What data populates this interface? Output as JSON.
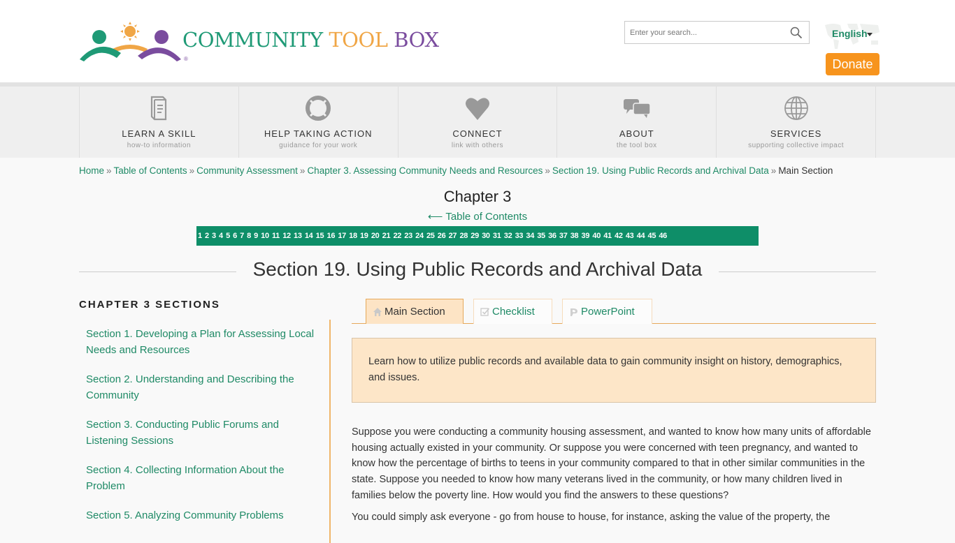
{
  "header": {
    "logo": {
      "word1": "COMMUNITY",
      "word2": "TOOL",
      "word3": "BOX",
      "registered": "®",
      "colors": {
        "green": "#1f9a76",
        "orange": "#f0a646",
        "purple": "#7a4c9e"
      }
    },
    "search": {
      "placeholder": "Enter your search...",
      "value": ""
    },
    "language": {
      "selected": "English"
    },
    "donate_label": "Donate"
  },
  "nav": {
    "items": [
      {
        "icon": "book-icon",
        "title": "LEARN A SKILL",
        "subtitle": "how-to information"
      },
      {
        "icon": "lifebuoy-icon",
        "title": "HELP TAKING ACTION",
        "subtitle": "guidance for your work"
      },
      {
        "icon": "heart-icon",
        "title": "CONNECT",
        "subtitle": "link with others"
      },
      {
        "icon": "chat-bubbles-icon",
        "title": "ABOUT",
        "subtitle": "the tool box"
      },
      {
        "icon": "globe-icon",
        "title": "SERVICES",
        "subtitle": "supporting collective impact"
      }
    ]
  },
  "breadcrumb": {
    "separator": "»",
    "links": [
      "Home",
      "Table of Contents",
      "Community Assessment",
      "Chapter 3. Assessing Community Needs and Resources",
      "Section 19. Using Public Records and Archival Data"
    ],
    "current": "Main Section"
  },
  "chapter": {
    "title": "Chapter 3",
    "toc_link": "⟵ Table of Contents",
    "pages": [
      "1",
      "2",
      "3",
      "4",
      "5",
      "6",
      "7",
      "8",
      "9",
      "10",
      "11",
      "12",
      "13",
      "14",
      "15",
      "16",
      "17",
      "18",
      "19",
      "20",
      "21",
      "22",
      "23",
      "24",
      "25",
      "26",
      "27",
      "28",
      "29",
      "30",
      "31",
      "32",
      "33",
      "34",
      "35",
      "36",
      "37",
      "38",
      "39",
      "40",
      "41",
      "42",
      "43",
      "44",
      "45",
      "46"
    ]
  },
  "section_title": "Section 19. Using Public Records and Archival Data",
  "sidebar": {
    "title": "CHAPTER 3 SECTIONS",
    "items": [
      "Section 1. Developing a Plan for Assessing Local Needs and Resources",
      "Section 2. Understanding and Describing the Community",
      "Section 3. Conducting Public Forums and Listening Sessions",
      "Section 4. Collecting Information About the Problem",
      "Section 5. Analyzing Community Problems"
    ]
  },
  "tabs": [
    {
      "label": "Main Section",
      "icon": "home-icon",
      "active": true
    },
    {
      "label": "Checklist",
      "icon": "checkbox-icon",
      "active": false
    },
    {
      "label": "PowerPoint",
      "icon": "powerpoint-icon",
      "active": false
    }
  ],
  "intro": "Learn how to utilize public records and available data to gain community insight on history, demographics, and issues.",
  "body": {
    "paragraphs": [
      "Suppose you were conducting a community housing assessment, and wanted to know how many units of affordable housing actually existed in your community. Or suppose you were concerned with teen pregnancy, and wanted to know how the percentage of births to teens in your community compared to that in other similar communities in the state. Suppose you needed to know how many veterans lived in the community, or how many children lived in families below the poverty line. How would you find the answers to these questions?",
      "You could simply ask everyone - go from house to house, for instance, asking the value of the property, the"
    ]
  },
  "colors": {
    "accent_green": "#1f8a66",
    "pager_green": "#0e8e68",
    "donate_orange": "#f7941d",
    "tab_active_bg": "#fde4c5",
    "intro_bg": "#fde6c8"
  }
}
